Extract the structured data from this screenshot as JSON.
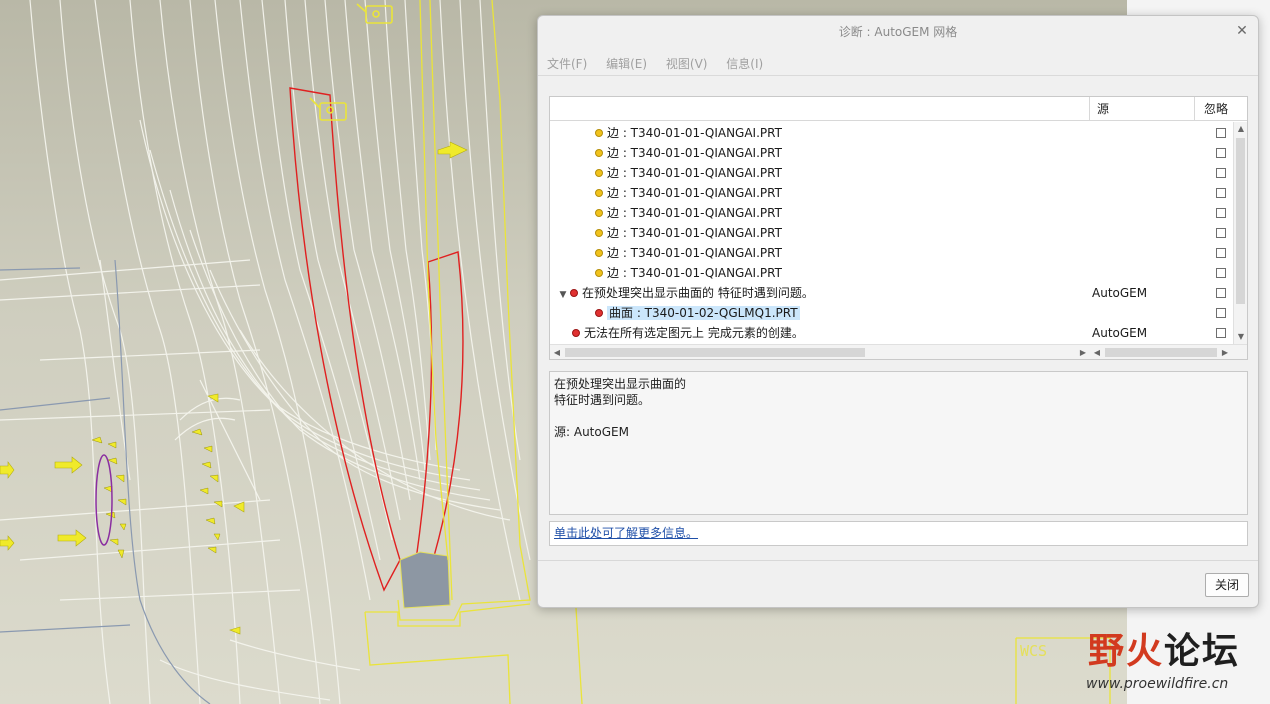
{
  "dialog": {
    "title": "诊断 : AutoGEM 网格",
    "menu": [
      "文件(F)",
      "编辑(E)",
      "视图(V)",
      "信息(I)"
    ],
    "tree": {
      "columns": {
        "name": "",
        "source": "源",
        "ignore": "忽略"
      },
      "rows": [
        {
          "dot": "yellow",
          "text": "边 : T340-01-01-QIANGAI.PRT",
          "source": ""
        },
        {
          "dot": "yellow",
          "text": "边 : T340-01-01-QIANGAI.PRT",
          "source": ""
        },
        {
          "dot": "yellow",
          "text": "边 : T340-01-01-QIANGAI.PRT",
          "source": ""
        },
        {
          "dot": "yellow",
          "text": "边 : T340-01-01-QIANGAI.PRT",
          "source": ""
        },
        {
          "dot": "yellow",
          "text": "边 : T340-01-01-QIANGAI.PRT",
          "source": ""
        },
        {
          "dot": "yellow",
          "text": "边 : T340-01-01-QIANGAI.PRT",
          "source": ""
        },
        {
          "dot": "yellow",
          "text": "边 : T340-01-01-QIANGAI.PRT",
          "source": ""
        },
        {
          "dot": "yellow",
          "text": "边 : T340-01-01-QIANGAI.PRT",
          "source": ""
        },
        {
          "dot": "red",
          "text": "在预处理突出显示曲面的 特征时遇到问题。",
          "source": "AutoGEM",
          "expanded": true
        },
        {
          "dot": "red",
          "text": "曲面 : T340-01-02-QGLMQ1.PRT",
          "source": "",
          "selected": true
        },
        {
          "dot": "red",
          "text": "无法在所有选定图元上 完成元素的创建。",
          "source": "AutoGEM"
        }
      ]
    },
    "details": {
      "line1": "在预处理突出显示曲面的",
      "line2": "特征时遇到问题。",
      "source_line": "源: AutoGEM"
    },
    "more_info_link": "单击此处可了解更多信息。",
    "close_button": "关闭"
  },
  "viewport": {
    "wcs_label": "WCS",
    "watermark": {
      "title_part1": "野火",
      "title_part2": "论坛",
      "url": "www.proewildfire.cn"
    }
  }
}
